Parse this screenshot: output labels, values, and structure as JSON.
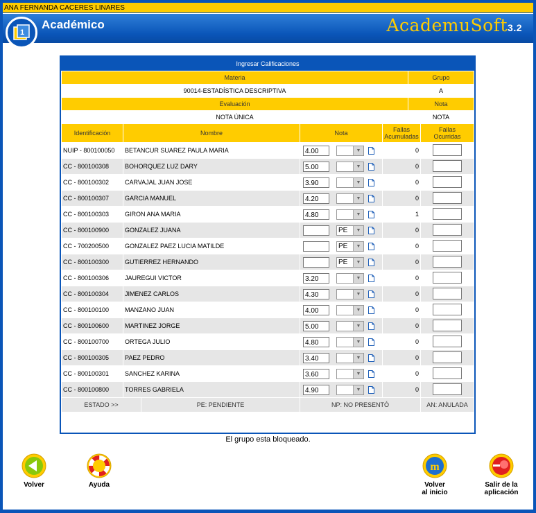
{
  "user": {
    "name": "ANA FERNANDA CACERES LINARES"
  },
  "header": {
    "title": "Académico",
    "brand": "AcademuSoft",
    "version": "3.2"
  },
  "panel": {
    "title": "Ingresar Calificaciones",
    "materia_label": "Materia",
    "grupo_label": "Grupo",
    "materia_value": "90014-ESTADÍSTICA DESCRIPTIVA",
    "grupo_value": "A",
    "evaluacion_label": "Evaluación",
    "nota_label": "Nota",
    "evaluacion_value": "NOTA ÚNICA",
    "nota_value": "NOTA",
    "columns": {
      "id": "Identificación",
      "nombre": "Nombre",
      "nota": "Nota",
      "fallas_acum_1": "Fallas",
      "fallas_acum_2": "Acumuladas",
      "fallas_ocur_1": "Fallas",
      "fallas_ocur_2": "Ocurridas"
    },
    "students": [
      {
        "id": "NUIP - 800100050",
        "name": "BETANCUR SUAREZ PAULA MARIA",
        "nota": "4.00",
        "estado": "",
        "fallas": "0"
      },
      {
        "id": "CC - 800100308",
        "name": "BOHORQUEZ LUZ DARY",
        "nota": "5.00",
        "estado": "",
        "fallas": "0"
      },
      {
        "id": "CC - 800100302",
        "name": "CARVAJAL JUAN JOSE",
        "nota": "3.90",
        "estado": "",
        "fallas": "0"
      },
      {
        "id": "CC - 800100307",
        "name": "GARCIA MANUEL",
        "nota": "4.20",
        "estado": "",
        "fallas": "0"
      },
      {
        "id": "CC - 800100303",
        "name": "GIRON ANA MARIA",
        "nota": "4.80",
        "estado": "",
        "fallas": "1"
      },
      {
        "id": "CC - 800100900",
        "name": "GONZALEZ JUANA",
        "nota": "",
        "estado": "PE",
        "fallas": "0"
      },
      {
        "id": "CC - 700200500",
        "name": "GONZALEZ PAEZ LUCIA MATILDE",
        "nota": "",
        "estado": "PE",
        "fallas": "0"
      },
      {
        "id": "CC - 800100300",
        "name": "GUTIERREZ HERNANDO",
        "nota": "",
        "estado": "PE",
        "fallas": "0"
      },
      {
        "id": "CC - 800100306",
        "name": "JAUREGUI VICTOR",
        "nota": "3.20",
        "estado": "",
        "fallas": "0"
      },
      {
        "id": "CC - 800100304",
        "name": "JIMENEZ CARLOS",
        "nota": "4.30",
        "estado": "",
        "fallas": "0"
      },
      {
        "id": "CC - 800100100",
        "name": "MANZANO JUAN",
        "nota": "4.00",
        "estado": "",
        "fallas": "0"
      },
      {
        "id": "CC - 800100600",
        "name": "MARTINEZ JORGE",
        "nota": "5.00",
        "estado": "",
        "fallas": "0"
      },
      {
        "id": "CC - 800100700",
        "name": "ORTEGA JULIO",
        "nota": "4.80",
        "estado": "",
        "fallas": "0"
      },
      {
        "id": "CC - 800100305",
        "name": "PAEZ PEDRO",
        "nota": "3.40",
        "estado": "",
        "fallas": "0"
      },
      {
        "id": "CC - 800100301",
        "name": "SANCHEZ KARINA",
        "nota": "3.60",
        "estado": "",
        "fallas": "0"
      },
      {
        "id": "CC - 800100800",
        "name": "TORRES GABRIELA",
        "nota": "4.90",
        "estado": "",
        "fallas": "0"
      }
    ],
    "legend": {
      "estado": "ESTADO >>",
      "pe": "PE: PENDIENTE",
      "np": "NP: NO PRESENTÓ",
      "an": "AN: ANULADA"
    }
  },
  "status_message": "El grupo esta bloqueado.",
  "buttons": {
    "volver": "Volver",
    "ayuda": "Ayuda",
    "inicio_1": "Volver",
    "inicio_2": "al inicio",
    "salir_1": "Salir de la",
    "salir_2": "aplicación"
  },
  "icons": {
    "logo": "book-icon",
    "volver": "back-arrow-icon",
    "ayuda": "lifebuoy-icon",
    "inicio": "home-icon",
    "salir": "exit-icon",
    "doc": "document-icon"
  },
  "colors": {
    "primary": "#0a55b8",
    "accent": "#ffcc00",
    "row_alt": "#e6e6e6"
  }
}
